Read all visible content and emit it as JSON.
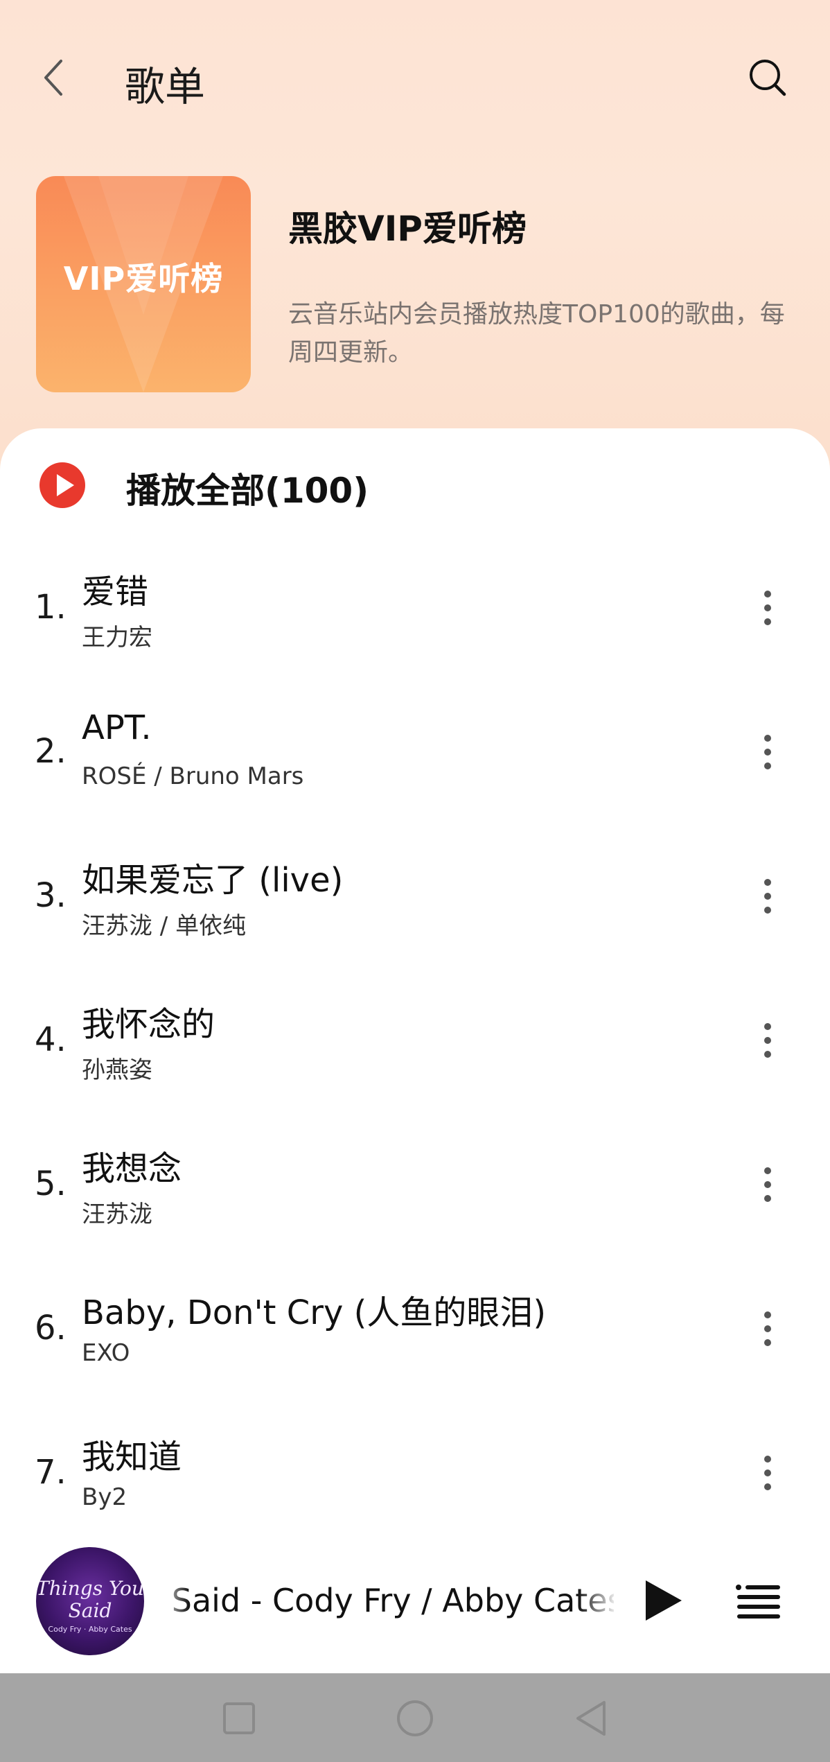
{
  "header": {
    "title": "歌单",
    "back_icon": "chevron-left-icon",
    "search_icon": "search-icon"
  },
  "playlist": {
    "cover_text": "VIP爱听榜",
    "name": "黑胶VIP爱听榜",
    "description": "云音乐站内会员播放热度TOP100的歌曲，每周四更新。",
    "accent_color": "#e8392d"
  },
  "play_all": {
    "label": "播放全部(100)",
    "icon": "play-circle-icon"
  },
  "songs": [
    {
      "index": "1.",
      "title": "爱错",
      "artist": "王力宏"
    },
    {
      "index": "2.",
      "title": "APT.",
      "artist": "ROSÉ / Bruno Mars"
    },
    {
      "index": "3.",
      "title": "如果爱忘了 (live)",
      "artist": "汪苏泷 / 单依纯"
    },
    {
      "index": "4.",
      "title": "我怀念的",
      "artist": "孙燕姿"
    },
    {
      "index": "5.",
      "title": "我想念",
      "artist": "汪苏泷"
    },
    {
      "index": "6.",
      "title": "Baby, Don't Cry (人鱼的眼泪)",
      "artist": "EXO"
    },
    {
      "index": "7.",
      "title": "我知道",
      "artist": "By2"
    }
  ],
  "player": {
    "now_playing": "u Said - Cody Fry / Abby Cates",
    "cover_text": "Things You Said",
    "cover_artists": "Cody Fry · Abby Cates",
    "play_icon": "play-icon",
    "playlist_icon": "playlist-icon"
  },
  "navbar": {
    "recent_icon": "square-icon",
    "home_icon": "circle-icon",
    "back_icon": "triangle-back-icon"
  }
}
